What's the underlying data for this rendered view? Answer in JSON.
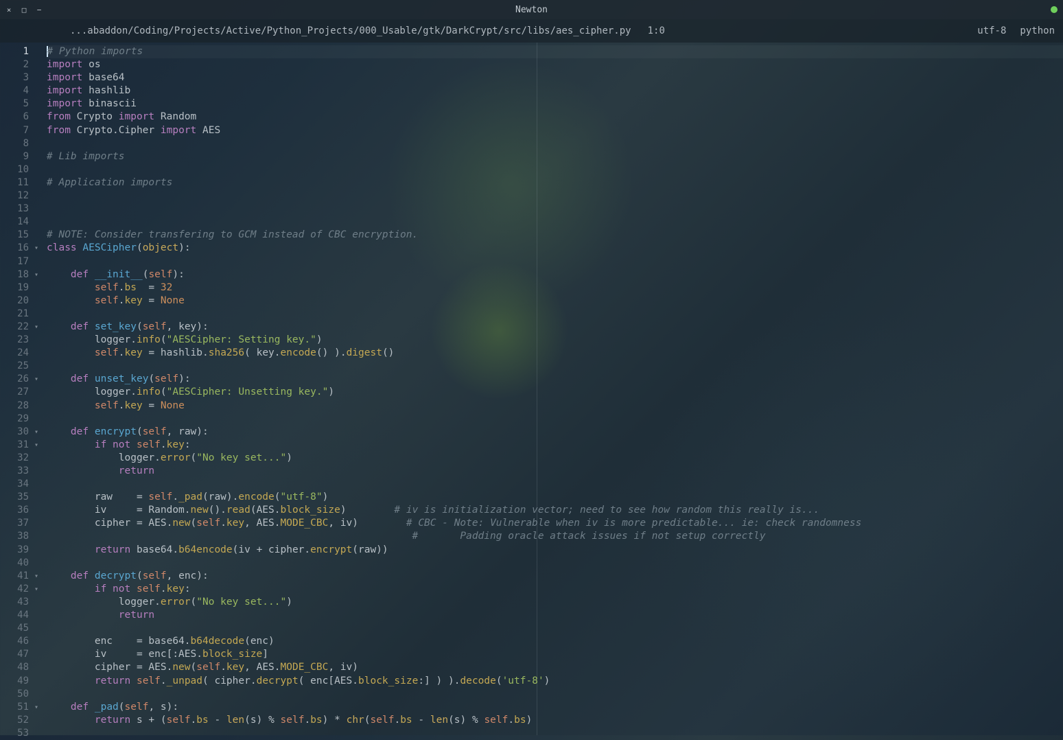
{
  "window": {
    "title": "Newton",
    "close": "×",
    "maximize": "□",
    "minimize": "−"
  },
  "tab": {
    "path": "...abaddon/Coding/Projects/Active/Python_Projects/000_Usable/gtk/DarkCrypt/src/libs/aes_cipher.py",
    "pos": "1:0",
    "encoding": "utf-8",
    "lang": "python"
  },
  "gutter": {
    "start": 1,
    "end": 53,
    "current": 1,
    "folds": [
      16,
      18,
      22,
      26,
      30,
      31,
      41,
      42,
      51
    ]
  },
  "code": [
    [
      [
        "cursor",
        ""
      ],
      [
        "c-comment",
        "# Python imports"
      ]
    ],
    [
      [
        "c-kw",
        "import"
      ],
      [
        "c-plain",
        " os"
      ]
    ],
    [
      [
        "c-kw",
        "import"
      ],
      [
        "c-plain",
        " base64"
      ]
    ],
    [
      [
        "c-kw",
        "import"
      ],
      [
        "c-plain",
        " hashlib"
      ]
    ],
    [
      [
        "c-kw",
        "import"
      ],
      [
        "c-plain",
        " binascii"
      ]
    ],
    [
      [
        "c-kw",
        "from"
      ],
      [
        "c-plain",
        " Crypto "
      ],
      [
        "c-kw",
        "import"
      ],
      [
        "c-plain",
        " Random"
      ]
    ],
    [
      [
        "c-kw",
        "from"
      ],
      [
        "c-plain",
        " Crypto.Cipher "
      ],
      [
        "c-kw",
        "import"
      ],
      [
        "c-plain",
        " AES"
      ]
    ],
    [],
    [
      [
        "c-comment",
        "# Lib imports"
      ]
    ],
    [],
    [
      [
        "c-comment",
        "# Application imports"
      ]
    ],
    [],
    [],
    [],
    [
      [
        "c-comment",
        "# NOTE: Consider transfering to GCM instead of CBC encryption."
      ]
    ],
    [
      [
        "c-kw",
        "class"
      ],
      [
        "c-plain",
        " "
      ],
      [
        "c-def",
        "AESCipher"
      ],
      [
        "c-plain",
        "("
      ],
      [
        "c-builtin",
        "object"
      ],
      [
        "c-plain",
        "):"
      ]
    ],
    [],
    [
      [
        "c-plain",
        "    "
      ],
      [
        "c-kw",
        "def"
      ],
      [
        "c-plain",
        " "
      ],
      [
        "c-def",
        "__init__"
      ],
      [
        "c-plain",
        "("
      ],
      [
        "c-self",
        "self"
      ],
      [
        "c-plain",
        "):"
      ]
    ],
    [
      [
        "c-plain",
        "        "
      ],
      [
        "c-self",
        "self"
      ],
      [
        "c-plain",
        "."
      ],
      [
        "c-attr",
        "bs"
      ],
      [
        "c-plain",
        "  = "
      ],
      [
        "c-num",
        "32"
      ]
    ],
    [
      [
        "c-plain",
        "        "
      ],
      [
        "c-self",
        "self"
      ],
      [
        "c-plain",
        "."
      ],
      [
        "c-attr",
        "key"
      ],
      [
        "c-plain",
        " = "
      ],
      [
        "c-const",
        "None"
      ]
    ],
    [],
    [
      [
        "c-plain",
        "    "
      ],
      [
        "c-kw",
        "def"
      ],
      [
        "c-plain",
        " "
      ],
      [
        "c-def",
        "set_key"
      ],
      [
        "c-plain",
        "("
      ],
      [
        "c-self",
        "self"
      ],
      [
        "c-plain",
        ", key):"
      ]
    ],
    [
      [
        "c-plain",
        "        logger."
      ],
      [
        "c-attr",
        "info"
      ],
      [
        "c-plain",
        "("
      ],
      [
        "c-str",
        "\"AESCipher: Setting key.\""
      ],
      [
        "c-plain",
        ")"
      ]
    ],
    [
      [
        "c-plain",
        "        "
      ],
      [
        "c-self",
        "self"
      ],
      [
        "c-plain",
        "."
      ],
      [
        "c-attr",
        "key"
      ],
      [
        "c-plain",
        " = hashlib."
      ],
      [
        "c-attr",
        "sha256"
      ],
      [
        "c-plain",
        "( key."
      ],
      [
        "c-attr",
        "encode"
      ],
      [
        "c-plain",
        "() )."
      ],
      [
        "c-attr",
        "digest"
      ],
      [
        "c-plain",
        "()"
      ]
    ],
    [],
    [
      [
        "c-plain",
        "    "
      ],
      [
        "c-kw",
        "def"
      ],
      [
        "c-plain",
        " "
      ],
      [
        "c-def",
        "unset_key"
      ],
      [
        "c-plain",
        "("
      ],
      [
        "c-self",
        "self"
      ],
      [
        "c-plain",
        "):"
      ]
    ],
    [
      [
        "c-plain",
        "        logger."
      ],
      [
        "c-attr",
        "info"
      ],
      [
        "c-plain",
        "("
      ],
      [
        "c-str",
        "\"AESCipher: Unsetting key.\""
      ],
      [
        "c-plain",
        ")"
      ]
    ],
    [
      [
        "c-plain",
        "        "
      ],
      [
        "c-self",
        "self"
      ],
      [
        "c-plain",
        "."
      ],
      [
        "c-attr",
        "key"
      ],
      [
        "c-plain",
        " = "
      ],
      [
        "c-const",
        "None"
      ]
    ],
    [],
    [
      [
        "c-plain",
        "    "
      ],
      [
        "c-kw",
        "def"
      ],
      [
        "c-plain",
        " "
      ],
      [
        "c-def",
        "encrypt"
      ],
      [
        "c-plain",
        "("
      ],
      [
        "c-self",
        "self"
      ],
      [
        "c-plain",
        ", raw):"
      ]
    ],
    [
      [
        "c-plain",
        "        "
      ],
      [
        "c-kw",
        "if"
      ],
      [
        "c-plain",
        " "
      ],
      [
        "c-kw",
        "not"
      ],
      [
        "c-plain",
        " "
      ],
      [
        "c-self",
        "self"
      ],
      [
        "c-plain",
        "."
      ],
      [
        "c-attr",
        "key"
      ],
      [
        "c-plain",
        ":"
      ]
    ],
    [
      [
        "c-plain",
        "            logger."
      ],
      [
        "c-attr",
        "error"
      ],
      [
        "c-plain",
        "("
      ],
      [
        "c-str",
        "\"No key set...\""
      ],
      [
        "c-plain",
        ")"
      ]
    ],
    [
      [
        "c-plain",
        "            "
      ],
      [
        "c-kw",
        "return"
      ]
    ],
    [],
    [
      [
        "c-plain",
        "        raw    = "
      ],
      [
        "c-self",
        "self"
      ],
      [
        "c-plain",
        "."
      ],
      [
        "c-attr",
        "_pad"
      ],
      [
        "c-plain",
        "(raw)."
      ],
      [
        "c-attr",
        "encode"
      ],
      [
        "c-plain",
        "("
      ],
      [
        "c-str",
        "\"utf-8\""
      ],
      [
        "c-plain",
        ")"
      ]
    ],
    [
      [
        "c-plain",
        "        iv     = Random."
      ],
      [
        "c-attr",
        "new"
      ],
      [
        "c-plain",
        "()."
      ],
      [
        "c-attr",
        "read"
      ],
      [
        "c-plain",
        "(AES."
      ],
      [
        "c-attr",
        "block_size"
      ],
      [
        "c-plain",
        ")        "
      ],
      [
        "c-comment",
        "# iv is initialization vector; need to see how random this really is..."
      ]
    ],
    [
      [
        "c-plain",
        "        cipher = AES."
      ],
      [
        "c-attr",
        "new"
      ],
      [
        "c-plain",
        "("
      ],
      [
        "c-self",
        "self"
      ],
      [
        "c-plain",
        "."
      ],
      [
        "c-attr",
        "key"
      ],
      [
        "c-plain",
        ", AES."
      ],
      [
        "c-attr",
        "MODE_CBC"
      ],
      [
        "c-plain",
        ", iv)        "
      ],
      [
        "c-comment",
        "# CBC - Note: Vulnerable when iv is more predictable... ie: check randomness"
      ]
    ],
    [
      [
        "c-plain",
        "                                                             "
      ],
      [
        "c-comment",
        "#       Padding oracle attack issues if not setup correctly"
      ]
    ],
    [
      [
        "c-plain",
        "        "
      ],
      [
        "c-kw",
        "return"
      ],
      [
        "c-plain",
        " base64."
      ],
      [
        "c-attr",
        "b64encode"
      ],
      [
        "c-plain",
        "(iv + cipher."
      ],
      [
        "c-attr",
        "encrypt"
      ],
      [
        "c-plain",
        "(raw))"
      ]
    ],
    [],
    [
      [
        "c-plain",
        "    "
      ],
      [
        "c-kw",
        "def"
      ],
      [
        "c-plain",
        " "
      ],
      [
        "c-def",
        "decrypt"
      ],
      [
        "c-plain",
        "("
      ],
      [
        "c-self",
        "self"
      ],
      [
        "c-plain",
        ", enc):"
      ]
    ],
    [
      [
        "c-plain",
        "        "
      ],
      [
        "c-kw",
        "if"
      ],
      [
        "c-plain",
        " "
      ],
      [
        "c-kw",
        "not"
      ],
      [
        "c-plain",
        " "
      ],
      [
        "c-self",
        "self"
      ],
      [
        "c-plain",
        "."
      ],
      [
        "c-attr",
        "key"
      ],
      [
        "c-plain",
        ":"
      ]
    ],
    [
      [
        "c-plain",
        "            logger."
      ],
      [
        "c-attr",
        "error"
      ],
      [
        "c-plain",
        "("
      ],
      [
        "c-str",
        "\"No key set...\""
      ],
      [
        "c-plain",
        ")"
      ]
    ],
    [
      [
        "c-plain",
        "            "
      ],
      [
        "c-kw",
        "return"
      ]
    ],
    [],
    [
      [
        "c-plain",
        "        enc    = base64."
      ],
      [
        "c-attr",
        "b64decode"
      ],
      [
        "c-plain",
        "(enc)"
      ]
    ],
    [
      [
        "c-plain",
        "        iv     = enc[:AES."
      ],
      [
        "c-attr",
        "block_size"
      ],
      [
        "c-plain",
        "]"
      ]
    ],
    [
      [
        "c-plain",
        "        cipher = AES."
      ],
      [
        "c-attr",
        "new"
      ],
      [
        "c-plain",
        "("
      ],
      [
        "c-self",
        "self"
      ],
      [
        "c-plain",
        "."
      ],
      [
        "c-attr",
        "key"
      ],
      [
        "c-plain",
        ", AES."
      ],
      [
        "c-attr",
        "MODE_CBC"
      ],
      [
        "c-plain",
        ", iv)"
      ]
    ],
    [
      [
        "c-plain",
        "        "
      ],
      [
        "c-kw",
        "return"
      ],
      [
        "c-plain",
        " "
      ],
      [
        "c-self",
        "self"
      ],
      [
        "c-plain",
        "."
      ],
      [
        "c-attr",
        "_unpad"
      ],
      [
        "c-plain",
        "( cipher."
      ],
      [
        "c-attr",
        "decrypt"
      ],
      [
        "c-plain",
        "( enc[AES."
      ],
      [
        "c-attr",
        "block_size"
      ],
      [
        "c-plain",
        ":] ) )."
      ],
      [
        "c-attr",
        "decode"
      ],
      [
        "c-plain",
        "("
      ],
      [
        "c-str",
        "'utf-8'"
      ],
      [
        "c-plain",
        ")"
      ]
    ],
    [],
    [
      [
        "c-plain",
        "    "
      ],
      [
        "c-kw",
        "def"
      ],
      [
        "c-plain",
        " "
      ],
      [
        "c-def",
        "_pad"
      ],
      [
        "c-plain",
        "("
      ],
      [
        "c-self",
        "self"
      ],
      [
        "c-plain",
        ", s):"
      ]
    ],
    [
      [
        "c-plain",
        "        "
      ],
      [
        "c-kw",
        "return"
      ],
      [
        "c-plain",
        " s + ("
      ],
      [
        "c-self",
        "self"
      ],
      [
        "c-plain",
        "."
      ],
      [
        "c-attr",
        "bs"
      ],
      [
        "c-plain",
        " - "
      ],
      [
        "c-builtin",
        "len"
      ],
      [
        "c-plain",
        "(s) % "
      ],
      [
        "c-self",
        "self"
      ],
      [
        "c-plain",
        "."
      ],
      [
        "c-attr",
        "bs"
      ],
      [
        "c-plain",
        ") * "
      ],
      [
        "c-builtin",
        "chr"
      ],
      [
        "c-plain",
        "("
      ],
      [
        "c-self",
        "self"
      ],
      [
        "c-plain",
        "."
      ],
      [
        "c-attr",
        "bs"
      ],
      [
        "c-plain",
        " - "
      ],
      [
        "c-builtin",
        "len"
      ],
      [
        "c-plain",
        "(s) % "
      ],
      [
        "c-self",
        "self"
      ],
      [
        "c-plain",
        "."
      ],
      [
        "c-attr",
        "bs"
      ],
      [
        "c-plain",
        ")"
      ]
    ],
    []
  ]
}
